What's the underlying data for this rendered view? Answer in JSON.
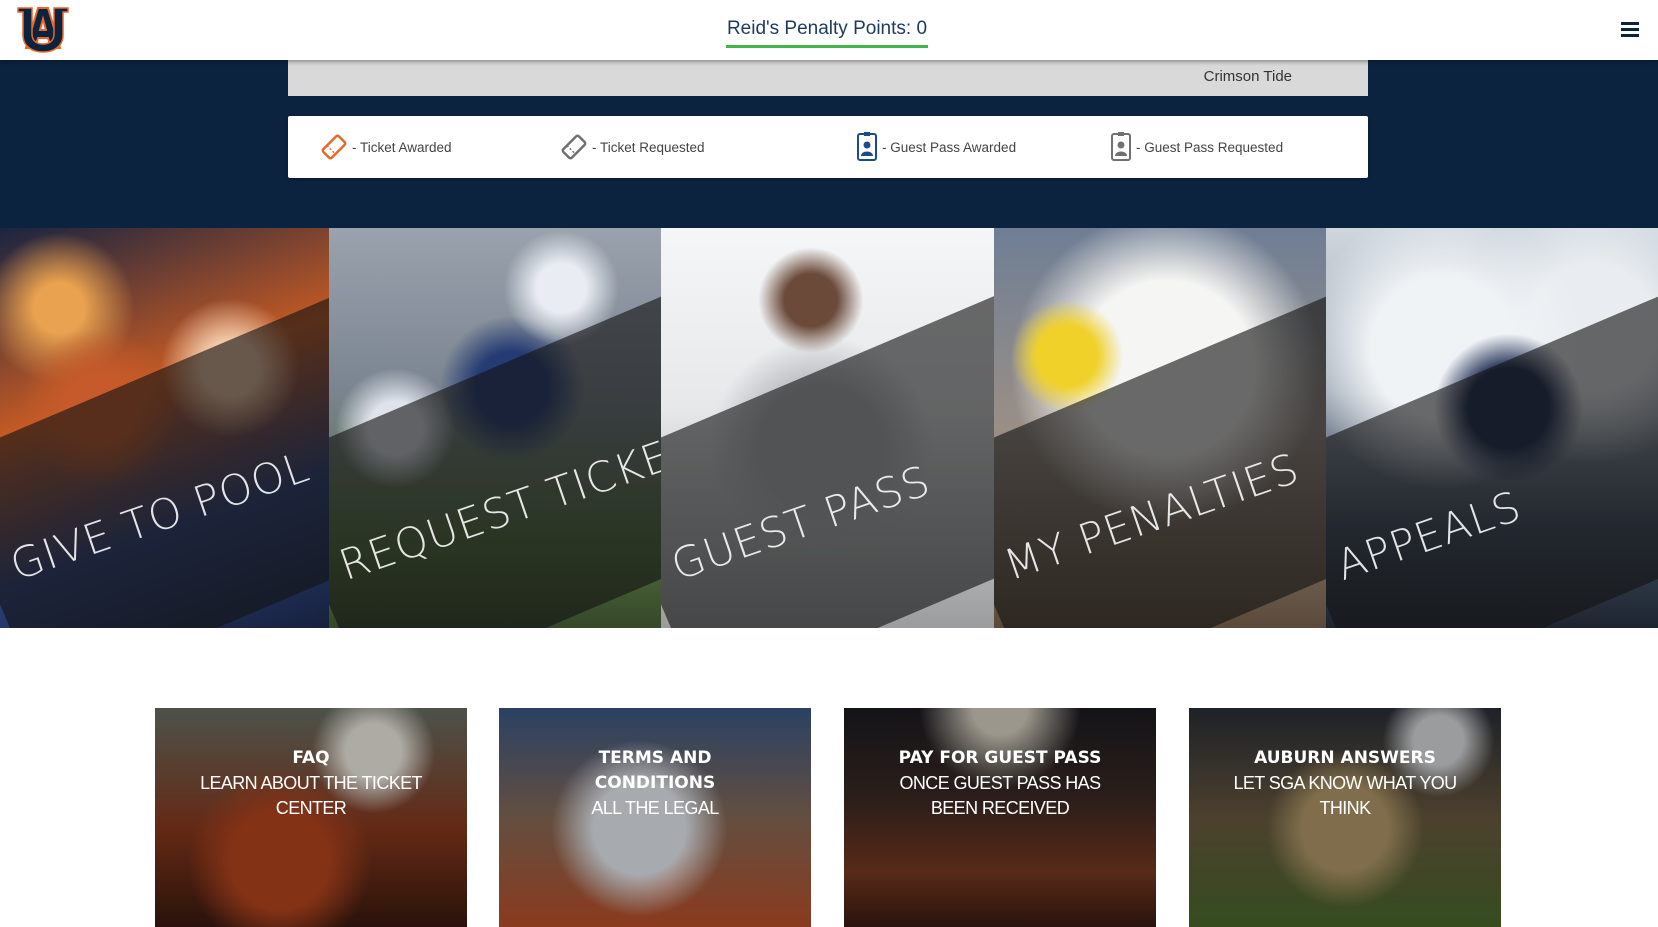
{
  "header": {
    "logo_text": "AU",
    "penalty_label": "Reid's Penalty Points: 0",
    "menu_icon": "hamburger-icon"
  },
  "game": {
    "opponent": "Crimson Tide"
  },
  "legend": [
    {
      "label": "- Ticket Awarded",
      "icon": "ticket-awarded-icon",
      "color": "#e8682a"
    },
    {
      "label": "- Ticket Requested",
      "icon": "ticket-requested-icon",
      "color": "#707070"
    },
    {
      "label": "- Guest Pass Awarded",
      "icon": "guest-pass-awarded-icon",
      "color": "#1f4a8a"
    },
    {
      "label": "- Guest Pass Requested",
      "icon": "guest-pass-requested-icon",
      "color": "#707070"
    }
  ],
  "tiles": [
    {
      "label": "GIVE TO POOL"
    },
    {
      "label": "REQUEST TICKET"
    },
    {
      "label": "GUEST PASS"
    },
    {
      "label": "MY PENALTIES"
    },
    {
      "label": "APPEALS"
    }
  ],
  "cards": [
    {
      "title": "FAQ",
      "line1": "LEARN ABOUT THE TICKET",
      "line2": "CENTER"
    },
    {
      "title": "TERMS AND",
      "line1": "CONDITIONS",
      "line2": "ALL THE LEGAL"
    },
    {
      "title": "PAY FOR GUEST PASS",
      "line1": "ONCE GUEST PASS HAS",
      "line2": "BEEN RECEIVED"
    },
    {
      "title": "AUBURN ANSWERS",
      "line1": "LET SGA KNOW WHAT YOU",
      "line2": "THINK"
    }
  ],
  "colors": {
    "navy": "#0c2340",
    "orange": "#e8682a",
    "green_underline": "#3fb54a"
  }
}
